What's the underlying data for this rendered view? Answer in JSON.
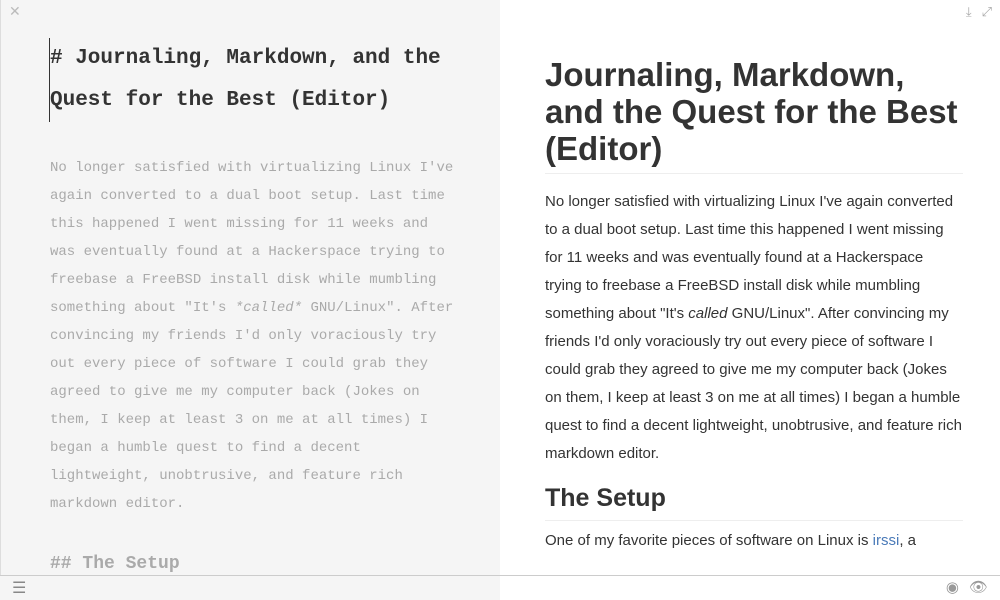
{
  "editor": {
    "close_icon": "close-icon",
    "heading": "# Journaling, Markdown, and the Quest for the Best (Editor)",
    "paragraph_before": "No longer satisfied with virtualizing Linux I've again converted to a dual boot setup. Last time this happened I went missing for 11 weeks and was eventually found at a Hackerspace trying to freebase a FreeBSD install disk while mumbling something about \"It's ",
    "paragraph_em": "*called*",
    "paragraph_after": " GNU/Linux\". After convincing my friends I'd only voraciously try out every piece of software I could grab they agreed to give me my computer back (Jokes on them, I keep at least 3 on me at all times) I began a humble quest to find a decent lightweight, unobtrusive, and feature rich markdown editor.",
    "subheading": "## The Setup"
  },
  "preview": {
    "title": "Journaling, Markdown, and the Quest for the Best (Editor)",
    "paragraph_before": "No longer satisfied with virtualizing Linux I've again converted to a dual boot setup. Last time this happened I went missing for 11 weeks and was eventually found at a Hackerspace trying to freebase a FreeBSD install disk while mumbling something about \"It's ",
    "paragraph_em": "called",
    "paragraph_after": " GNU/Linux\". After convincing my friends I'd only voraciously try out every piece of software I could grab they agreed to give me my computer back (Jokes on them, I keep at least 3 on me at all times) I began a humble quest to find a decent lightweight, unobtrusive, and feature rich markdown editor.",
    "subheading": "The Setup",
    "next_before": "One of my favorite pieces of software on Linux is ",
    "next_link": "irssi",
    "next_after": ", a",
    "link_color": "#4a7ab8"
  },
  "toolbar": {
    "download_icon": "download-icon",
    "fullscreen_icon": "expand-icon",
    "menu_icon": "menu-icon",
    "target_icon": "target-icon",
    "eye_icon": "eye-icon"
  }
}
